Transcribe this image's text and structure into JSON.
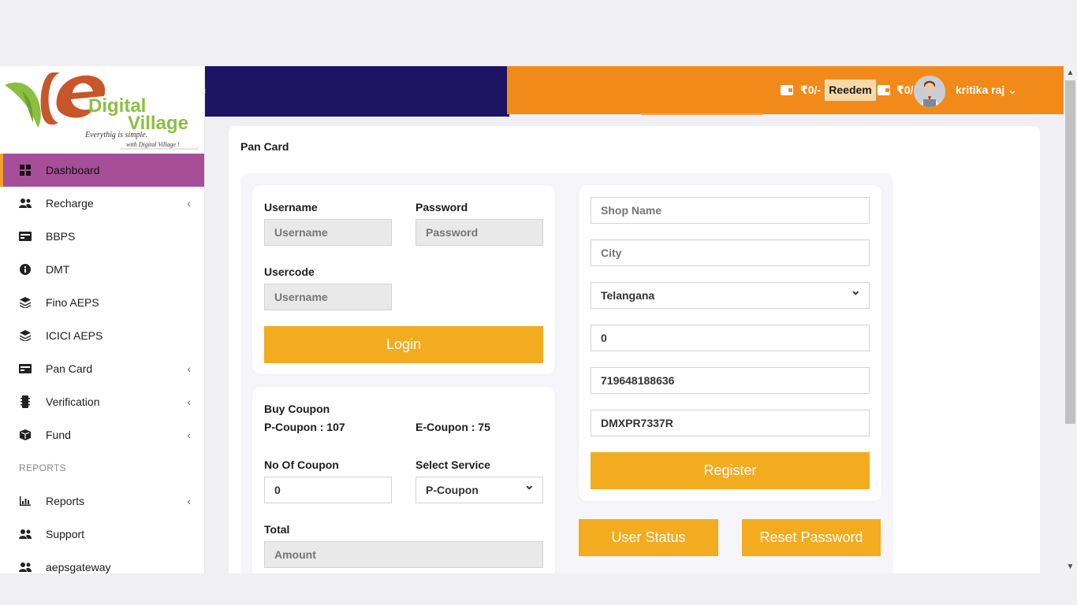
{
  "brand": {
    "logo_main": "Digital",
    "logo_sub": "Village",
    "tagline1": "Everythig is simple.",
    "tagline2": "with Digital Village !"
  },
  "sidebar": {
    "items": [
      {
        "label": "Dashboard",
        "icon": "grid-icon",
        "active": true,
        "chevron": false
      },
      {
        "label": "Recharge",
        "icon": "users-icon",
        "chevron": true
      },
      {
        "label": "BBPS",
        "icon": "card-icon",
        "chevron": false
      },
      {
        "label": "DMT",
        "icon": "info-icon",
        "chevron": false
      },
      {
        "label": "Fino AEPS",
        "icon": "layers-icon",
        "chevron": false
      },
      {
        "label": "ICICI AEPS",
        "icon": "layers-icon",
        "chevron": false
      },
      {
        "label": "Pan Card",
        "icon": "card-icon",
        "chevron": true
      },
      {
        "label": "Verification",
        "icon": "chip-icon",
        "chevron": true
      },
      {
        "label": "Fund",
        "icon": "box-icon",
        "chevron": true
      }
    ],
    "section_reports": "REPORTS",
    "report_items": [
      {
        "label": "Reports",
        "icon": "chart-icon",
        "chevron": true
      },
      {
        "label": "Support",
        "icon": "users-icon",
        "chevron": false
      },
      {
        "label": "aepsgateway",
        "icon": "users-icon",
        "chevron": false
      }
    ]
  },
  "header": {
    "wallet1": "₹0/-",
    "redeem_label": "Reedem",
    "wallet2": "₹0/",
    "user_name": "kritika raj",
    "user_chevron": "⌄",
    "accent": "#f28a1a",
    "nav_color": "#1d1464"
  },
  "page": {
    "title": "Pan Card"
  },
  "login": {
    "username_label": "Username",
    "username_placeholder": "Username",
    "password_label": "Password",
    "password_placeholder": "Password",
    "usercode_label": "Usercode",
    "usercode_placeholder": "Username",
    "login_button": "Login"
  },
  "coupon": {
    "title": "Buy Coupon",
    "p_coupon": "P-Coupon : 107",
    "e_coupon": "E-Coupon : 75",
    "no_of_coupon_label": "No Of Coupon",
    "no_of_coupon_value": "0",
    "select_service_label": "Select Service",
    "select_service_value": "P-Coupon",
    "total_label": "Total",
    "amount_placeholder": "Amount"
  },
  "register": {
    "shop_name_placeholder": "Shop Name",
    "city_placeholder": "City",
    "state_value": "Telangana",
    "pincode_value": "0",
    "aadhaar_value": "719648188636",
    "pan_value": "DMXPR7337R",
    "register_button": "Register",
    "user_status_button": "User Status",
    "reset_password_button": "Reset Password",
    "button_color": "#f3ab20"
  }
}
